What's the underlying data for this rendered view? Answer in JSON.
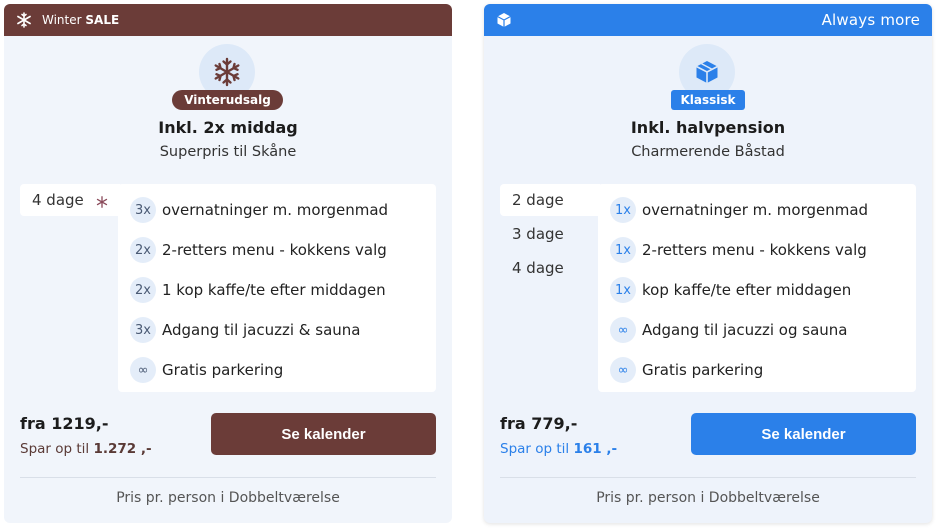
{
  "colors": {
    "brown": "#6b3c38",
    "blue": "#2b80e9"
  },
  "cards": [
    {
      "banner_icon": "snowflake-icon",
      "banner_left_prefix": "Winter ",
      "banner_left_bold": "SALE",
      "banner_right": "",
      "hero_icon": "snowflake-icon",
      "badge": "Vinterudsalg",
      "title": "Inkl. 2x middag",
      "subtitle": "Superpris til Skåne",
      "days": [
        "4 dage"
      ],
      "features": [
        {
          "qty": "3x",
          "text": "overnatninger m. morgenmad"
        },
        {
          "qty": "2x",
          "text": "2-retters menu - kokkens valg"
        },
        {
          "qty": "2x",
          "text": "1 kop kaffe/te efter middagen"
        },
        {
          "qty": "3x",
          "text": "Adgang til jacuzzi & sauna"
        },
        {
          "qty": "∞",
          "text": "Gratis parkering"
        }
      ],
      "price": "fra 1219,-",
      "save_prefix": "Spar op til ",
      "save_amount": "1.272 ,-",
      "cta": "Se kalender",
      "footer": "Pris pr. person i Dobbeltværelse"
    },
    {
      "banner_icon": "cube-icon",
      "banner_left_prefix": "",
      "banner_left_bold": "",
      "banner_right": "Always more",
      "hero_icon": "cube-icon",
      "badge": "Klassisk",
      "title": "Inkl. halvpension",
      "subtitle": "Charmerende Båstad",
      "days": [
        "2 dage",
        "3 dage",
        "4 dage"
      ],
      "features": [
        {
          "qty": "1x",
          "text": "overnatninger m. morgenmad"
        },
        {
          "qty": "1x",
          "text": "2-retters menu - kokkens valg"
        },
        {
          "qty": "1x",
          "text": "kop kaffe/te efter middagen"
        },
        {
          "qty": "∞",
          "text": "Adgang til jacuzzi og sauna"
        },
        {
          "qty": "∞",
          "text": "Gratis parkering"
        }
      ],
      "price": "fra 779,-",
      "save_prefix": "Spar op til ",
      "save_amount": "161 ,-",
      "cta": "Se kalender",
      "footer": "Pris pr. person i Dobbeltværelse"
    }
  ]
}
